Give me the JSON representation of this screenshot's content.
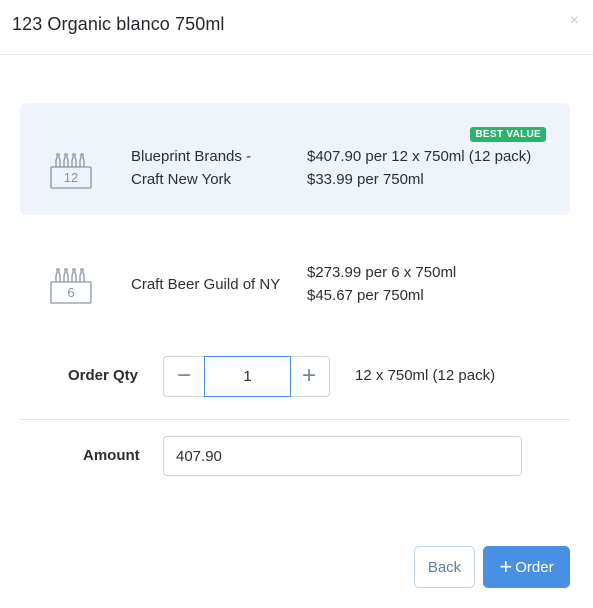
{
  "modal": {
    "title": "123 Organic blanco 750ml",
    "close_icon": "×"
  },
  "options": [
    {
      "selected": true,
      "pack_count": "12",
      "vendor_line1": "Blueprint Brands -",
      "vendor_line2": "Craft New York",
      "price_pack": "$407.90 per 12 x 750ml (12 pack)",
      "price_unit": "$33.99 per 750ml",
      "badge": "BEST VALUE",
      "icon": "bottle-pack-icon"
    },
    {
      "selected": false,
      "pack_count": "6",
      "vendor_line1": "Craft Beer Guild of NY",
      "price_pack": "$273.99 per 6 x 750ml",
      "price_unit": "$45.67 per 750ml",
      "icon": "bottle-pack-icon"
    }
  ],
  "order_qty": {
    "label": "Order Qty",
    "value": "1",
    "minus_icon": "−",
    "plus_icon": "+",
    "pack_description": "12 x 750ml (12 pack)"
  },
  "amount": {
    "label": "Amount",
    "value": "407.90"
  },
  "footer": {
    "back_label": "Back",
    "order_label": "Order",
    "order_icon": "+"
  },
  "colors": {
    "accent": "#4a90e2",
    "badge": "#2bb36b",
    "selected_bg": "#eef4f9",
    "icon_gray": "#8a96a6"
  }
}
